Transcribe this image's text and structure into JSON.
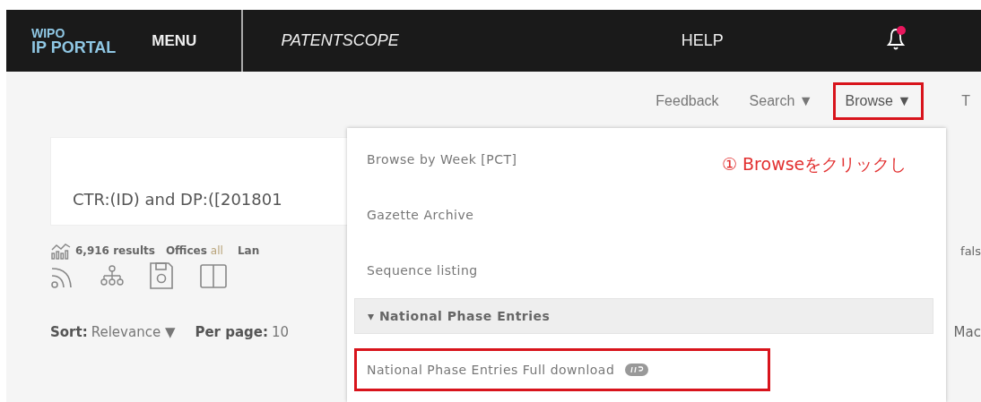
{
  "navbar": {
    "logo_top": "WIPO",
    "logo_bottom": "IP PORTAL",
    "menu": "MENU",
    "product": "PATENTSCOPE",
    "help": "HELP",
    "notification": true
  },
  "links": [
    {
      "label": "Feedback",
      "highlight": false
    },
    {
      "label": "Search ▼",
      "highlight": false
    },
    {
      "label": "Browse ▼",
      "highlight": true
    },
    {
      "label": "T",
      "highlight": false
    }
  ],
  "query": {
    "value": "CTR:(ID) and DP:([201801"
  },
  "results": {
    "count": "6,916 results",
    "offices_label": "Offices",
    "offices_value": "all",
    "language_label": "Lan",
    "right_text": "fals"
  },
  "sort": {
    "label": "Sort:",
    "value": "Relevance ▼",
    "per_page_label": "Per page:",
    "per_page_value": "10",
    "right_text": "Mac"
  },
  "dropdown": {
    "items": [
      {
        "label": "Browse by Week [PCT]",
        "kind": "item",
        "highlight": false
      },
      {
        "label": "Gazette Archive",
        "kind": "item",
        "highlight": false
      },
      {
        "label": "Sequence listing",
        "kind": "item",
        "highlight": false
      },
      {
        "label": "▾ National Phase Entries",
        "kind": "header",
        "highlight": false
      },
      {
        "label": "National Phase Entries Full download",
        "kind": "item",
        "highlight": true,
        "badge": true
      }
    ]
  },
  "annotation": {
    "text": "① Browseをクリックし"
  }
}
